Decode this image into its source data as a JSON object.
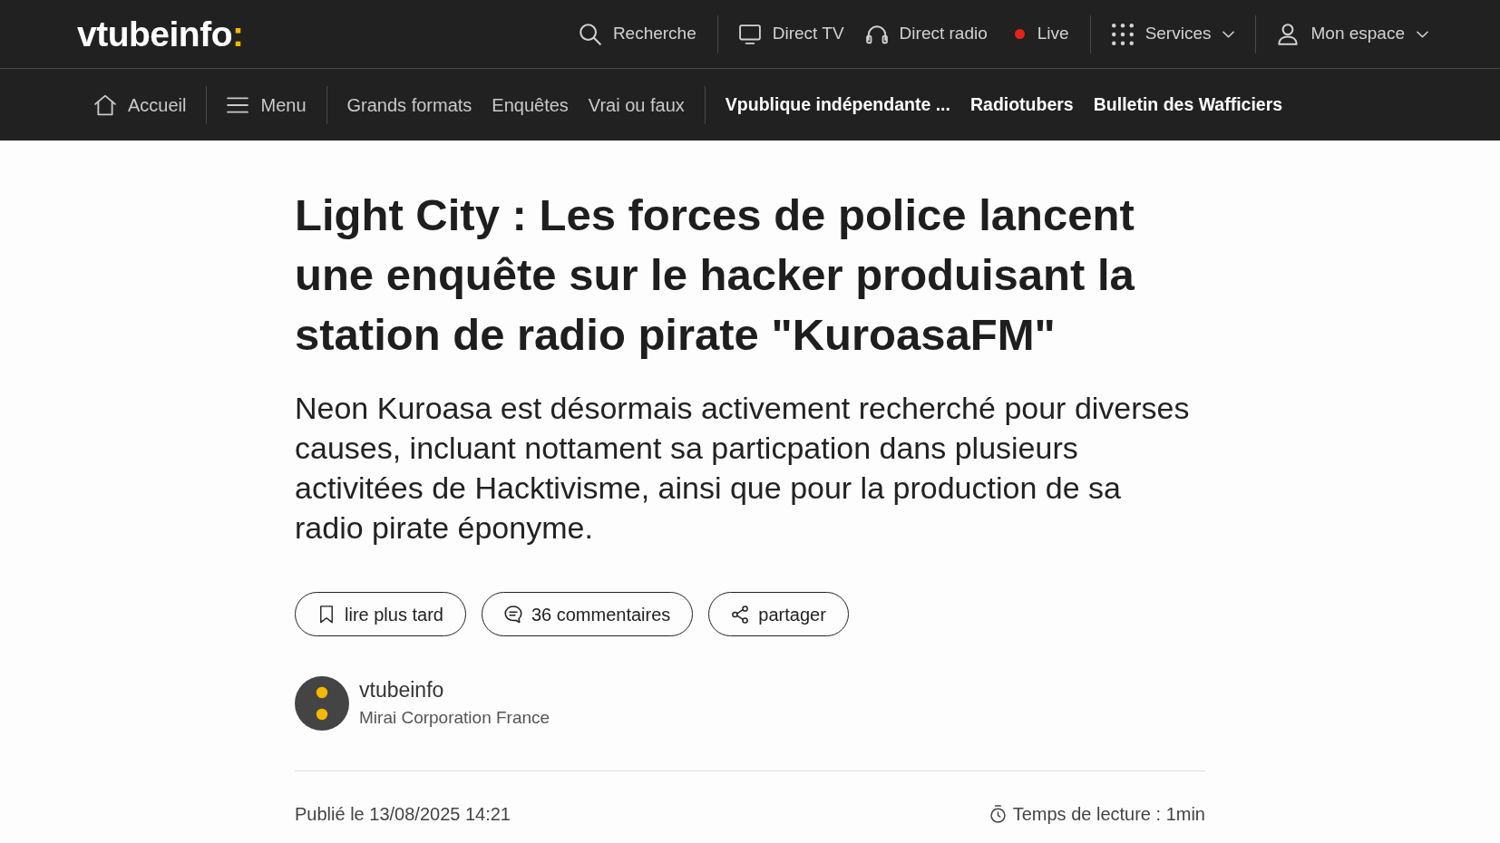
{
  "header": {
    "logo": {
      "text": "vtubeinfo",
      "accent": ":"
    },
    "top_groups": [
      {
        "items": [
          {
            "kind": "search",
            "label": "Recherche",
            "dropdown": false
          }
        ]
      },
      {
        "items": [
          {
            "kind": "tv",
            "label": "Direct TV",
            "dropdown": false
          },
          {
            "kind": "radio",
            "label": "Direct radio",
            "dropdown": false
          },
          {
            "kind": "live",
            "label": "Live",
            "dropdown": false
          }
        ]
      },
      {
        "items": [
          {
            "kind": "services",
            "label": "Services",
            "dropdown": true
          }
        ]
      },
      {
        "items": [
          {
            "kind": "account",
            "label": "Mon espace",
            "dropdown": true
          }
        ]
      }
    ],
    "nav_groups": [
      {
        "items": [
          {
            "kind": "home",
            "label": "Accueil",
            "emphasized": false
          }
        ]
      },
      {
        "items": [
          {
            "kind": "menu",
            "label": "Menu",
            "emphasized": false
          }
        ]
      },
      {
        "items": [
          {
            "kind": "link",
            "label": "Grands formats",
            "emphasized": false
          },
          {
            "kind": "link",
            "label": "Enquêtes",
            "emphasized": false
          },
          {
            "kind": "link",
            "label": "Vrai ou faux",
            "emphasized": false
          }
        ]
      },
      {
        "items": [
          {
            "kind": "link",
            "label": "Vpublique indépendante ...",
            "emphasized": true
          },
          {
            "kind": "link",
            "label": "Radiotubers",
            "emphasized": true
          },
          {
            "kind": "link",
            "label": "Bulletin des Wafficiers",
            "emphasized": true
          }
        ]
      }
    ]
  },
  "article": {
    "title": "Light City : Les forces de police lancent une enquête sur le hacker produisant la station de radio pirate \"KuroasaFM\"",
    "lead": "Neon Kuroasa est désormais activement recherché pour diverses causes, incluant nottament sa particpation dans plusieurs activitées de Hacktivisme, ainsi que pour la production de sa radio pirate éponyme.",
    "actions": [
      {
        "kind": "bookmark",
        "label": "lire plus tard"
      },
      {
        "kind": "comments",
        "label": "36 commentaires"
      },
      {
        "kind": "share",
        "label": "partager"
      }
    ],
    "author": {
      "name": "vtubeinfo",
      "organization": "Mirai Corporation France"
    },
    "published": "Publié le 13/08/2025 14:21",
    "reading_time": "Temps de lecture : 1min"
  }
}
